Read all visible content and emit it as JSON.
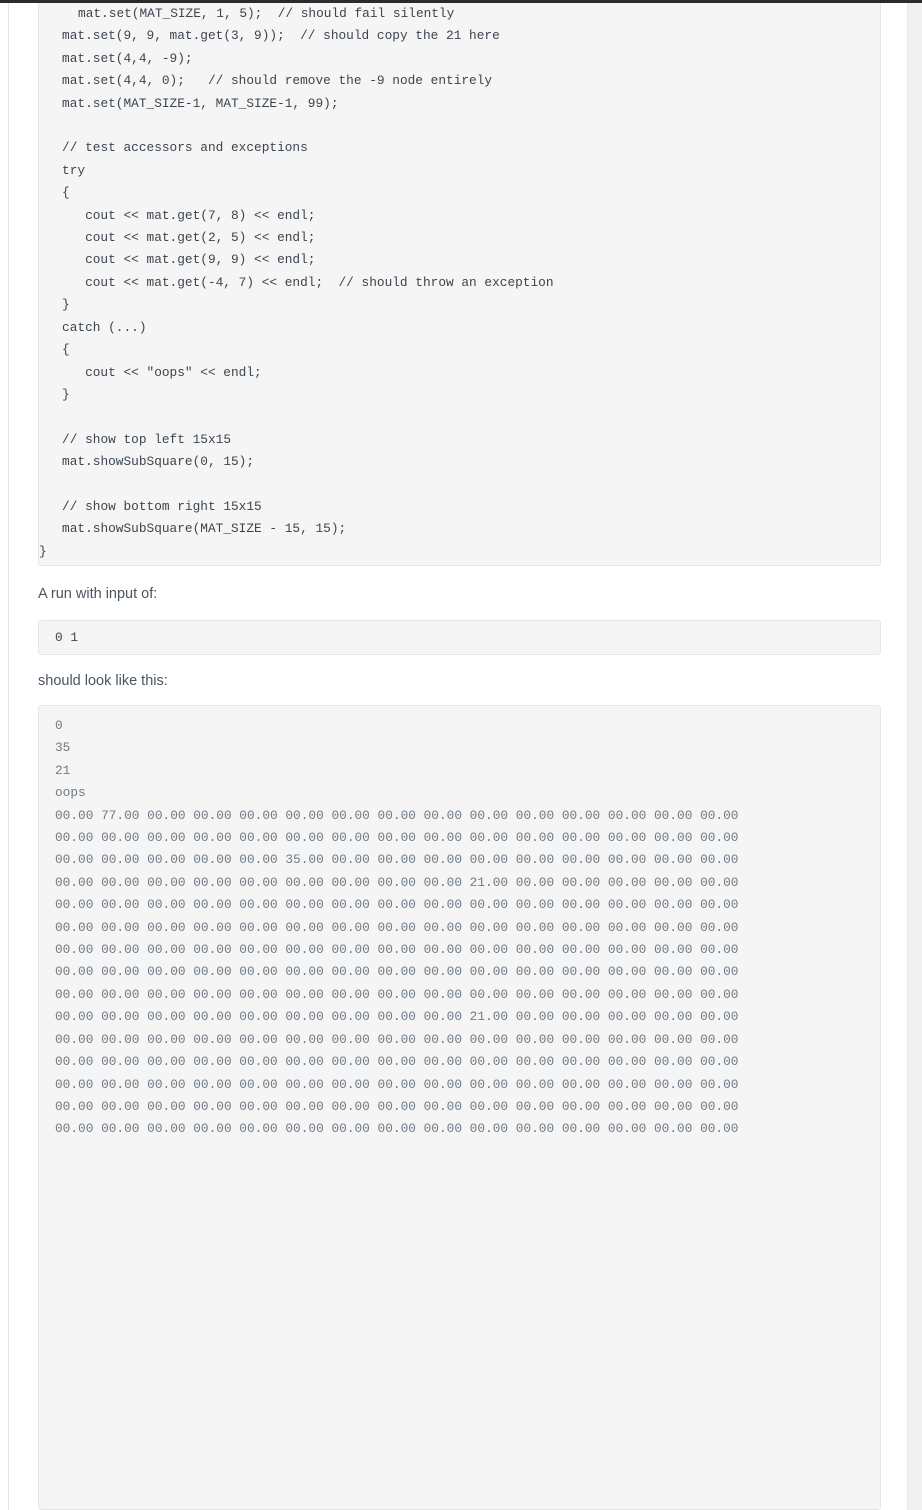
{
  "theme": {
    "page_background": "#ffffff",
    "code_block_background": "#f5f5f5",
    "code_block_border": "#e6e6e6",
    "code_text": "#3b454f",
    "body_text": "#4a5560",
    "output_text": "#6f7b86",
    "scrollbar_track": "#f1f1f1",
    "top_bar": "#2b2b2b"
  },
  "code_blocks": {
    "driver_source": {
      "language": "cpp",
      "lines": [
        "   mat.set(MAT_SIZE, 1, 5);  // should fail silently",
        "   mat.set(9, 9, mat.get(3, 9));  // should copy the 21 here",
        "   mat.set(4,4, -9);",
        "   mat.set(4,4, 0);   // should remove the -9 node entirely",
        "   mat.set(MAT_SIZE-1, MAT_SIZE-1, 99);",
        "",
        "   // test accessors and exceptions",
        "   try",
        "   {",
        "      cout << mat.get(7, 8) << endl;",
        "      cout << mat.get(2, 5) << endl;",
        "      cout << mat.get(9, 9) << endl;",
        "      cout << mat.get(-4, 7) << endl;  // should throw an exception",
        "   }",
        "   catch (...)",
        "   {",
        "      cout << \"oops\" << endl;",
        "   }",
        "",
        "   // show top left 15x15",
        "   mat.showSubSquare(0, 15);",
        "",
        "   // show bottom right 15x15",
        "   mat.showSubSquare(MAT_SIZE - 15, 15);",
        "}"
      ]
    },
    "sample_input": {
      "lines": [
        "0 1"
      ]
    },
    "expected_output": {
      "scalar_lines": [
        "0",
        "35",
        "21",
        "oops"
      ],
      "matrix_rows": [
        "00.00 77.00 00.00 00.00 00.00 00.00 00.00 00.00 00.00 00.00 00.00 00.00 00.00 00.00 00.00",
        "00.00 00.00 00.00 00.00 00.00 00.00 00.00 00.00 00.00 00.00 00.00 00.00 00.00 00.00 00.00",
        "00.00 00.00 00.00 00.00 00.00 35.00 00.00 00.00 00.00 00.00 00.00 00.00 00.00 00.00 00.00",
        "00.00 00.00 00.00 00.00 00.00 00.00 00.00 00.00 00.00 21.00 00.00 00.00 00.00 00.00 00.00",
        "00.00 00.00 00.00 00.00 00.00 00.00 00.00 00.00 00.00 00.00 00.00 00.00 00.00 00.00 00.00",
        "00.00 00.00 00.00 00.00 00.00 00.00 00.00 00.00 00.00 00.00 00.00 00.00 00.00 00.00 00.00",
        "00.00 00.00 00.00 00.00 00.00 00.00 00.00 00.00 00.00 00.00 00.00 00.00 00.00 00.00 00.00",
        "00.00 00.00 00.00 00.00 00.00 00.00 00.00 00.00 00.00 00.00 00.00 00.00 00.00 00.00 00.00",
        "00.00 00.00 00.00 00.00 00.00 00.00 00.00 00.00 00.00 00.00 00.00 00.00 00.00 00.00 00.00",
        "00.00 00.00 00.00 00.00 00.00 00.00 00.00 00.00 00.00 21.00 00.00 00.00 00.00 00.00 00.00",
        "00.00 00.00 00.00 00.00 00.00 00.00 00.00 00.00 00.00 00.00 00.00 00.00 00.00 00.00 00.00",
        "00.00 00.00 00.00 00.00 00.00 00.00 00.00 00.00 00.00 00.00 00.00 00.00 00.00 00.00 00.00",
        "00.00 00.00 00.00 00.00 00.00 00.00 00.00 00.00 00.00 00.00 00.00 00.00 00.00 00.00 00.00",
        "00.00 00.00 00.00 00.00 00.00 00.00 00.00 00.00 00.00 00.00 00.00 00.00 00.00 00.00 00.00",
        "00.00 00.00 00.00 00.00 00.00 00.00 00.00 00.00 00.00 00.00 00.00 00.00 00.00 00.00 00.00"
      ]
    }
  },
  "prose": {
    "run_with_input_label": "A run with input of:",
    "should_look_like_label": "should look like this:"
  }
}
